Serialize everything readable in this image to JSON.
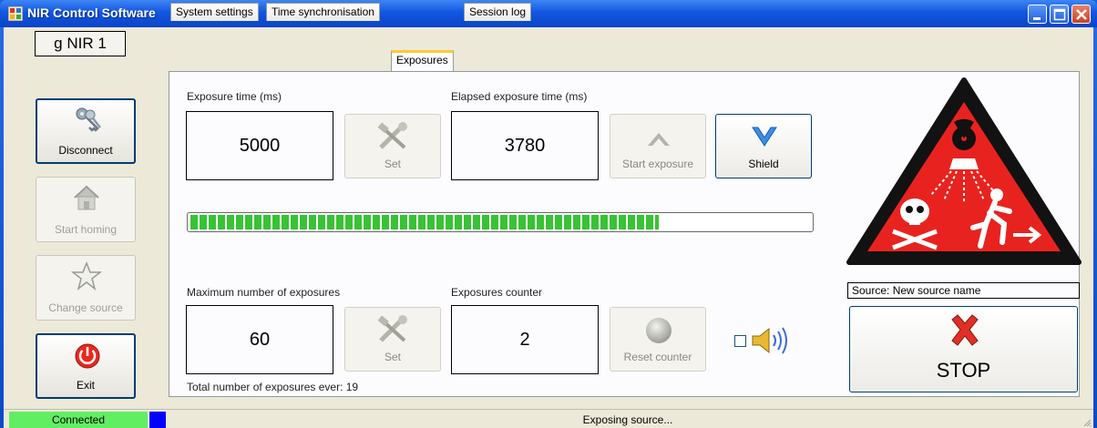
{
  "window": {
    "title": "NIR Control Software",
    "icon": "app-grid-icon"
  },
  "sidebar": {
    "device_name": "g NIR 1",
    "buttons": [
      {
        "label": "Disconnect",
        "icon": "keys-icon",
        "enabled": true
      },
      {
        "label": "Start homing",
        "icon": "house-icon",
        "enabled": false
      },
      {
        "label": "Change source",
        "icon": "star-icon",
        "enabled": false
      },
      {
        "label": "Exit",
        "icon": "power-icon",
        "enabled": true
      }
    ]
  },
  "tabs": [
    {
      "label": "System settings",
      "active": false
    },
    {
      "label": "Time synchronisation",
      "active": false
    },
    {
      "label": "Exposures",
      "active": true
    },
    {
      "label": "Session log",
      "active": false
    }
  ],
  "exposures": {
    "exposure_time_label": "Exposure time (ms)",
    "exposure_time_value": "5000",
    "set_exposure_label": "Set",
    "elapsed_label": "Elapsed exposure time (ms)",
    "elapsed_value": "3780",
    "start_exposure_label": "Start exposure",
    "shield_label": "Shield",
    "progress_fraction": 0.756,
    "max_exposures_label": "Maximum number of exposures",
    "max_exposures_value": "60",
    "set_max_label": "Set",
    "counter_label": "Exposures counter",
    "counter_value": "2",
    "reset_counter_label": "Reset counter",
    "sound_checked": false,
    "total_exposures_text": "Total number of exposures ever: 19"
  },
  "source": {
    "text": "Source: New source name",
    "stop_label": "STOP"
  },
  "statusbar": {
    "connection": "Connected",
    "connection_color": "#62ee62",
    "indicator_color": "#0000ff",
    "message": "Exposing source..."
  }
}
